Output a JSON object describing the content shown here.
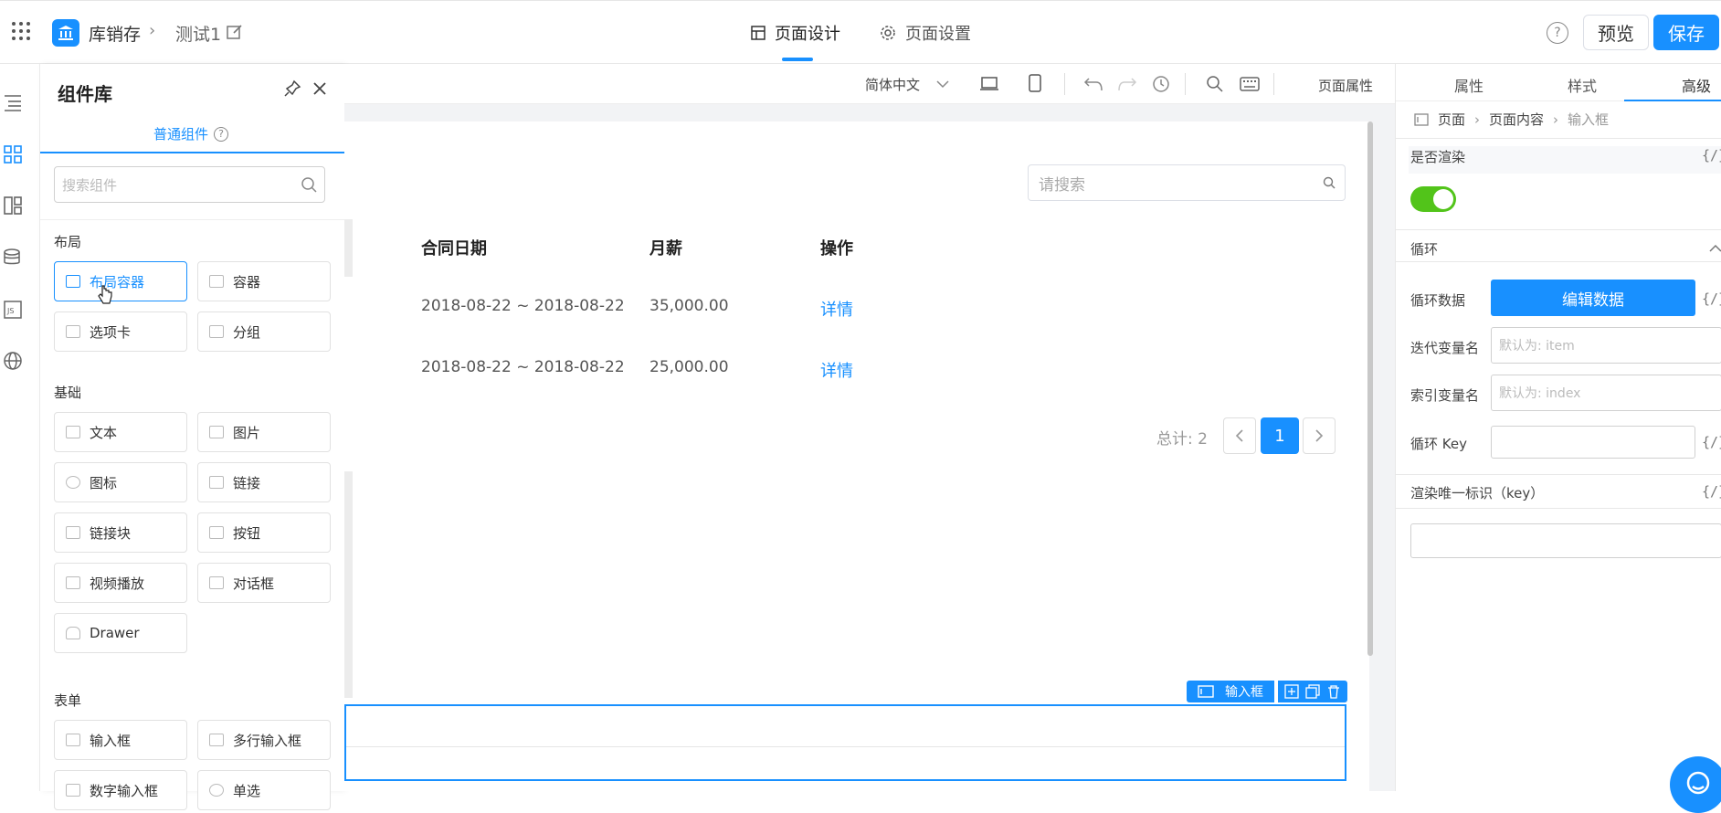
{
  "topbar": {
    "app_name": "库销存",
    "page_name": "测试1",
    "tabs": [
      {
        "label": "页面设计"
      },
      {
        "label": "页面设置"
      }
    ],
    "preview_label": "预览",
    "save_label": "保存",
    "help_glyph": "?"
  },
  "toolbar": {
    "language": "简体中文",
    "page_props_label": "页面属性"
  },
  "component_panel": {
    "title": "组件库",
    "tab_label": "普通组件",
    "search_placeholder": "搜索组件",
    "sections": [
      {
        "title": "布局",
        "items": [
          "布局容器",
          "容器",
          "选项卡",
          "分组"
        ]
      },
      {
        "title": "基础",
        "items": [
          "文本",
          "图片",
          "图标",
          "链接",
          "链接块",
          "按钮",
          "视频播放",
          "对话框",
          "Drawer"
        ]
      },
      {
        "title": "表单",
        "items": [
          "输入框",
          "多行输入框",
          "数字输入框",
          "单选"
        ]
      }
    ]
  },
  "canvas": {
    "search_placeholder": "请搜索",
    "table": {
      "columns": [
        "合同日期",
        "月薪",
        "操作"
      ],
      "rows": [
        {
          "date": "2018-08-22 ~ 2018-08-22",
          "salary": "35,000.00",
          "action": "详情"
        },
        {
          "date": "2018-08-22 ~ 2018-08-22",
          "salary": "25,000.00",
          "action": "详情"
        }
      ]
    },
    "pagination": {
      "total_label": "总计: 2",
      "current_page": "1"
    },
    "selected_component_label": "输入框"
  },
  "right_panel": {
    "tabs": [
      "属性",
      "样式",
      "高级"
    ],
    "active_tab": "高级",
    "breadcrumb": [
      "页面",
      "页面内容",
      "输入框"
    ],
    "render_label": "是否渲染",
    "render_enabled": true,
    "loop_section": "循环",
    "loop_data_label": "循环数据",
    "edit_data_button": "编辑数据",
    "iter_var_label": "迭代变量名",
    "iter_var_placeholder": "默认为: item",
    "index_var_label": "索引变量名",
    "index_var_placeholder": "默认为: index",
    "loop_key_label": "循环 Key",
    "unique_key_label": "渲染唯一标识（key）",
    "fx_label": "{/}"
  },
  "colors": {
    "accent": "#1890ff",
    "toggle": "#52c41a"
  }
}
